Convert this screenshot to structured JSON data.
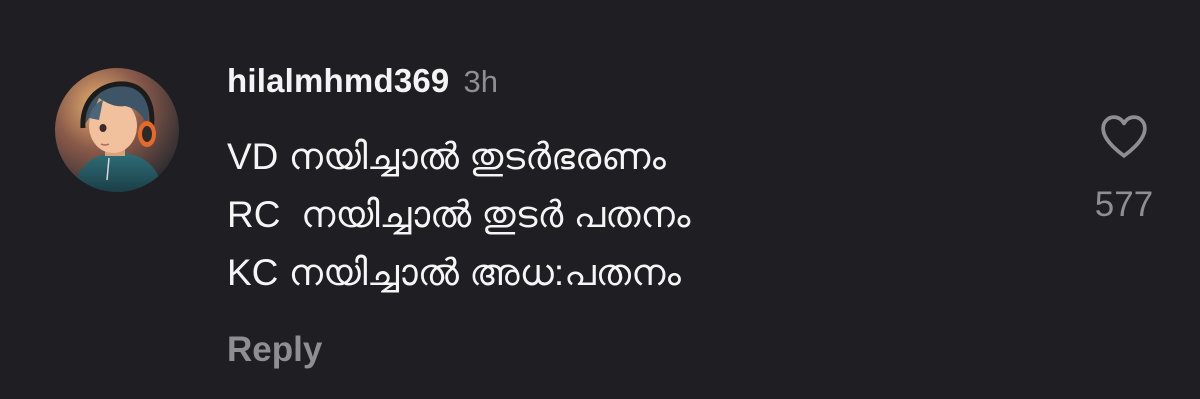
{
  "comment": {
    "avatar_icon": "user-avatar-anime-boy-headphones",
    "username": "hilalmhmd369",
    "timestamp": "3h",
    "lines": [
      "VD നയിച്ചാൽ തുടർഭരണം",
      "RC  നയിച്ചാൽ തുടർ പതനം",
      "KC നയിച്ചാൽ അധ:പതനം"
    ],
    "reply_label": "Reply",
    "like_icon": "heart-outline-icon",
    "like_count": "577"
  },
  "colors": {
    "background": "#1f1f23",
    "primary_text": "#f5f5f5",
    "secondary_text": "#8e8e93"
  }
}
